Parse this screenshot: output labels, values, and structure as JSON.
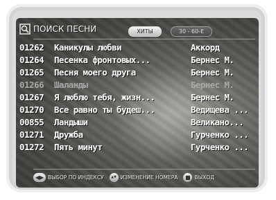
{
  "header": {
    "title": "ПОИСК ПЕСНИ"
  },
  "tabs": [
    {
      "label": "ХИТЫ",
      "active": true
    },
    {
      "label": "30 - 60-Е",
      "active": false
    }
  ],
  "songs": [
    {
      "code": "01262",
      "title": "Каникулы любви",
      "artist": "Аккорд"
    },
    {
      "code": "01264",
      "title": "Песенка фронтовых...",
      "artist": "Бернес М."
    },
    {
      "code": "01265",
      "title": "Песня моего друга",
      "artist": "Бернес М."
    },
    {
      "code": "01266",
      "title": "Шаланды",
      "artist": "Бернес М.",
      "dim": true
    },
    {
      "code": "01267",
      "title": "Я люблю тебя, жизн...",
      "artist": "Бернес М."
    },
    {
      "code": "01270",
      "title": "Все равно ты будеш...",
      "artist": "Ведищева ..."
    },
    {
      "code": "00855",
      "title": "Ландыши",
      "artist": "Великано..."
    },
    {
      "code": "01271",
      "title": "Дружба",
      "artist": "Гурченко ..."
    },
    {
      "code": "01272",
      "title": "Пять минут",
      "artist": "Гурченко ..."
    }
  ],
  "footer": {
    "index_label": "ВЫБОР ПО ИНДЕКСУ",
    "number_label": "ИЗМЕНЕНИЕ НОМЕРА",
    "exit_label": "ВЫХОД",
    "icons": {
      "left_right": "◀▶",
      "up_down": "▲▼",
      "exit": "■"
    }
  }
}
